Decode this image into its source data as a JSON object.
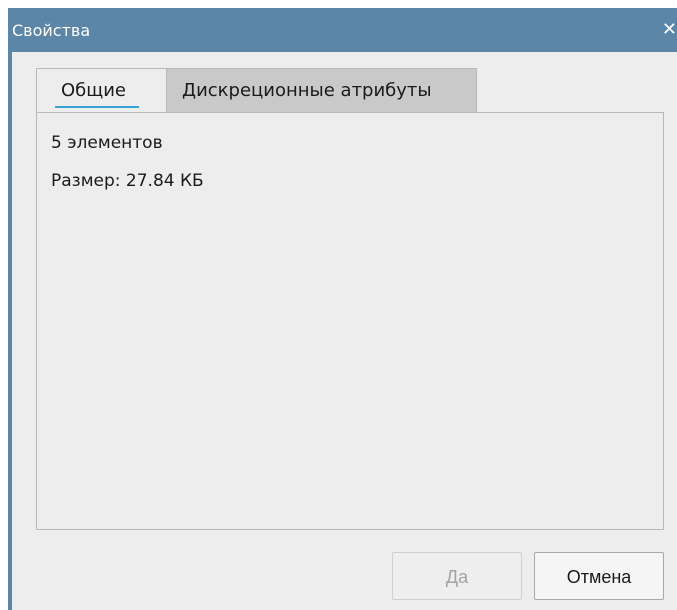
{
  "window": {
    "title": "Свойства",
    "close_glyph": "✕"
  },
  "tabs": [
    {
      "label": "Общие",
      "active": true
    },
    {
      "label": "Дискреционные атрибуты",
      "active": false
    }
  ],
  "general": {
    "items_count": "5 элементов",
    "size": "Размер: 27.84 КБ"
  },
  "buttons": {
    "ok_label": "Да",
    "ok_enabled": false,
    "cancel_label": "Отмена"
  },
  "colors": {
    "titlebar": "#5b86a8",
    "active_tab_indicator": "#3aa3d9"
  }
}
